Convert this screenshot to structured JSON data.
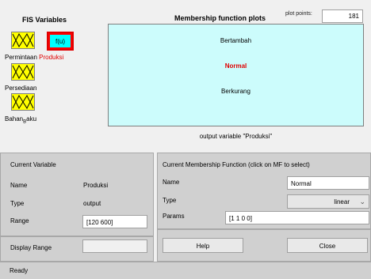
{
  "fis": {
    "title": "FIS Variables",
    "inputs": [
      {
        "name": "Permintaan",
        "icon": "input-mf-icon"
      },
      {
        "name": "Persediaan",
        "icon": "input-mf-icon"
      },
      {
        "name": "Bahan_Baku_main",
        "display": "Bahan",
        "subscript": "B",
        "suffix": "aku",
        "icon": "input-mf-icon"
      }
    ],
    "output": {
      "name": "Produksi",
      "box_label": "f(u)"
    }
  },
  "plot": {
    "title": "Membership function plots",
    "points_label": "plot points:",
    "points_value": "181",
    "mf_names": [
      "Bertambah",
      "Normal",
      "Berkurang"
    ],
    "selected_mf": "Normal",
    "caption": "output variable \"Produksi\""
  },
  "current_variable": {
    "title": "Current Variable",
    "name_label": "Name",
    "name_value": "Produksi",
    "type_label": "Type",
    "type_value": "output",
    "range_label": "Range",
    "range_value": "[120 600]",
    "display_range_label": "Display Range",
    "display_range_value": ""
  },
  "current_mf": {
    "title": "Current Membership Function (click on MF to select)",
    "name_label": "Name",
    "name_value": "Normal",
    "type_label": "Type",
    "type_value": "linear",
    "params_label": "Params",
    "params_value": "[1 1 0 0]"
  },
  "buttons": {
    "help": "Help",
    "close": "Close"
  },
  "status": "Ready",
  "colors": {
    "mf_box": "#ffff00",
    "output_box": "#00ffff",
    "selected_border": "#e00000",
    "plot_bg": "#ccfcfc",
    "selected_mf": "#e00000"
  }
}
